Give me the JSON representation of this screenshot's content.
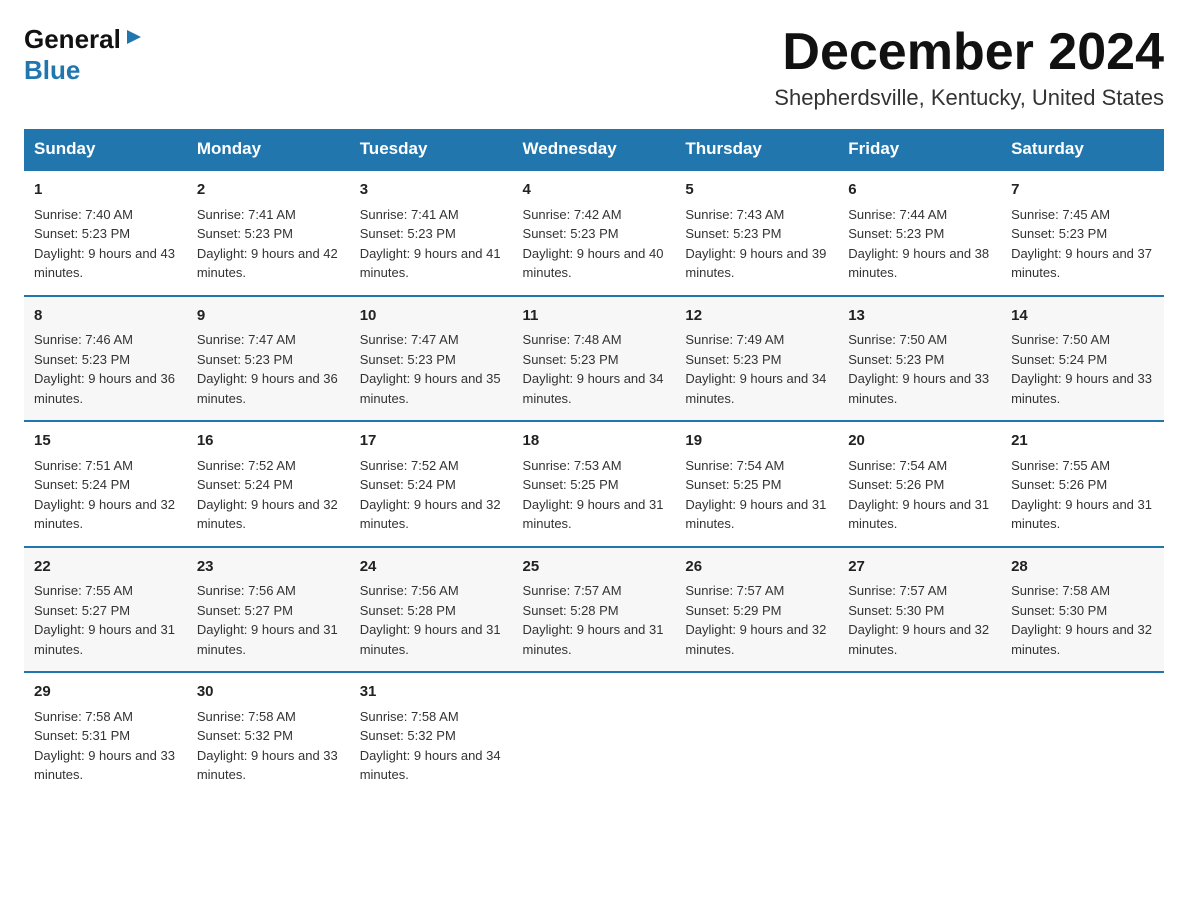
{
  "logo": {
    "general": "General",
    "blue": "Blue"
  },
  "header": {
    "month": "December 2024",
    "location": "Shepherdsville, Kentucky, United States"
  },
  "days_of_week": [
    "Sunday",
    "Monday",
    "Tuesday",
    "Wednesday",
    "Thursday",
    "Friday",
    "Saturday"
  ],
  "weeks": [
    [
      {
        "day": "1",
        "sunrise": "7:40 AM",
        "sunset": "5:23 PM",
        "daylight": "9 hours and 43 minutes."
      },
      {
        "day": "2",
        "sunrise": "7:41 AM",
        "sunset": "5:23 PM",
        "daylight": "9 hours and 42 minutes."
      },
      {
        "day": "3",
        "sunrise": "7:41 AM",
        "sunset": "5:23 PM",
        "daylight": "9 hours and 41 minutes."
      },
      {
        "day": "4",
        "sunrise": "7:42 AM",
        "sunset": "5:23 PM",
        "daylight": "9 hours and 40 minutes."
      },
      {
        "day": "5",
        "sunrise": "7:43 AM",
        "sunset": "5:23 PM",
        "daylight": "9 hours and 39 minutes."
      },
      {
        "day": "6",
        "sunrise": "7:44 AM",
        "sunset": "5:23 PM",
        "daylight": "9 hours and 38 minutes."
      },
      {
        "day": "7",
        "sunrise": "7:45 AM",
        "sunset": "5:23 PM",
        "daylight": "9 hours and 37 minutes."
      }
    ],
    [
      {
        "day": "8",
        "sunrise": "7:46 AM",
        "sunset": "5:23 PM",
        "daylight": "9 hours and 36 minutes."
      },
      {
        "day": "9",
        "sunrise": "7:47 AM",
        "sunset": "5:23 PM",
        "daylight": "9 hours and 36 minutes."
      },
      {
        "day": "10",
        "sunrise": "7:47 AM",
        "sunset": "5:23 PM",
        "daylight": "9 hours and 35 minutes."
      },
      {
        "day": "11",
        "sunrise": "7:48 AM",
        "sunset": "5:23 PM",
        "daylight": "9 hours and 34 minutes."
      },
      {
        "day": "12",
        "sunrise": "7:49 AM",
        "sunset": "5:23 PM",
        "daylight": "9 hours and 34 minutes."
      },
      {
        "day": "13",
        "sunrise": "7:50 AM",
        "sunset": "5:23 PM",
        "daylight": "9 hours and 33 minutes."
      },
      {
        "day": "14",
        "sunrise": "7:50 AM",
        "sunset": "5:24 PM",
        "daylight": "9 hours and 33 minutes."
      }
    ],
    [
      {
        "day": "15",
        "sunrise": "7:51 AM",
        "sunset": "5:24 PM",
        "daylight": "9 hours and 32 minutes."
      },
      {
        "day": "16",
        "sunrise": "7:52 AM",
        "sunset": "5:24 PM",
        "daylight": "9 hours and 32 minutes."
      },
      {
        "day": "17",
        "sunrise": "7:52 AM",
        "sunset": "5:24 PM",
        "daylight": "9 hours and 32 minutes."
      },
      {
        "day": "18",
        "sunrise": "7:53 AM",
        "sunset": "5:25 PM",
        "daylight": "9 hours and 31 minutes."
      },
      {
        "day": "19",
        "sunrise": "7:54 AM",
        "sunset": "5:25 PM",
        "daylight": "9 hours and 31 minutes."
      },
      {
        "day": "20",
        "sunrise": "7:54 AM",
        "sunset": "5:26 PM",
        "daylight": "9 hours and 31 minutes."
      },
      {
        "day": "21",
        "sunrise": "7:55 AM",
        "sunset": "5:26 PM",
        "daylight": "9 hours and 31 minutes."
      }
    ],
    [
      {
        "day": "22",
        "sunrise": "7:55 AM",
        "sunset": "5:27 PM",
        "daylight": "9 hours and 31 minutes."
      },
      {
        "day": "23",
        "sunrise": "7:56 AM",
        "sunset": "5:27 PM",
        "daylight": "9 hours and 31 minutes."
      },
      {
        "day": "24",
        "sunrise": "7:56 AM",
        "sunset": "5:28 PM",
        "daylight": "9 hours and 31 minutes."
      },
      {
        "day": "25",
        "sunrise": "7:57 AM",
        "sunset": "5:28 PM",
        "daylight": "9 hours and 31 minutes."
      },
      {
        "day": "26",
        "sunrise": "7:57 AM",
        "sunset": "5:29 PM",
        "daylight": "9 hours and 32 minutes."
      },
      {
        "day": "27",
        "sunrise": "7:57 AM",
        "sunset": "5:30 PM",
        "daylight": "9 hours and 32 minutes."
      },
      {
        "day": "28",
        "sunrise": "7:58 AM",
        "sunset": "5:30 PM",
        "daylight": "9 hours and 32 minutes."
      }
    ],
    [
      {
        "day": "29",
        "sunrise": "7:58 AM",
        "sunset": "5:31 PM",
        "daylight": "9 hours and 33 minutes."
      },
      {
        "day": "30",
        "sunrise": "7:58 AM",
        "sunset": "5:32 PM",
        "daylight": "9 hours and 33 minutes."
      },
      {
        "day": "31",
        "sunrise": "7:58 AM",
        "sunset": "5:32 PM",
        "daylight": "9 hours and 34 minutes."
      },
      null,
      null,
      null,
      null
    ]
  ]
}
